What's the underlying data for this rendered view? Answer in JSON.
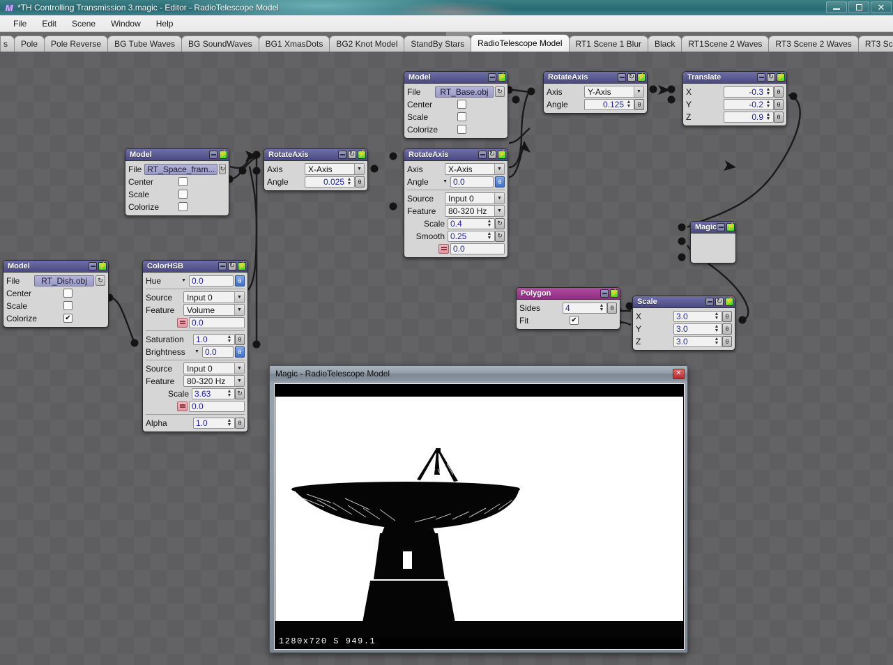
{
  "window": {
    "title": "*TH Controlling Transmission 3.magic - Editor - RadioTelescope Model",
    "app_icon": "M",
    "minimize": "–",
    "maximize": "❐",
    "close": "✕"
  },
  "menubar": {
    "items": [
      {
        "label": "File"
      },
      {
        "label": "Edit"
      },
      {
        "label": "Scene"
      },
      {
        "label": "Window"
      },
      {
        "label": "Help"
      }
    ]
  },
  "tabbar": {
    "tabs": [
      {
        "label": "s",
        "active": false
      },
      {
        "label": "Pole",
        "active": false
      },
      {
        "label": "Pole Reverse",
        "active": false
      },
      {
        "label": "BG Tube Waves",
        "active": false
      },
      {
        "label": "BG SoundWaves",
        "active": false
      },
      {
        "label": "BG1 XmasDots",
        "active": false
      },
      {
        "label": "BG2 Knot Model",
        "active": false
      },
      {
        "label": "StandBy Stars",
        "active": false
      },
      {
        "label": "RadioTelescope Model",
        "active": true
      },
      {
        "label": "RT1 Scene 1 Blur",
        "active": false
      },
      {
        "label": "Black",
        "active": false
      },
      {
        "label": "RT1Scene 2 Waves",
        "active": false
      },
      {
        "label": "RT3 Scene 2 Waves",
        "active": false
      },
      {
        "label": "RT3 Scene 0 Black",
        "active": false
      }
    ]
  },
  "colors": {
    "node_header": "#4a4a80",
    "node_header_magenta": "#8d2f7e",
    "bolt_green": "#49d81d",
    "accent_blue": "#3f6fc8",
    "canvas": "#5e5e60",
    "titlebar": "#2e7279"
  },
  "nodes": {
    "model_spaceframe": {
      "title": "Model",
      "file_label": "File",
      "file_value": "RT_Space_fram...",
      "center_label": "Center",
      "center_checked": false,
      "scale_label": "Scale",
      "scale_checked": false,
      "colorize_label": "Colorize",
      "colorize_checked": false
    },
    "rotateaxis_x": {
      "title": "RotateAxis",
      "axis_label": "Axis",
      "axis_value": "X-Axis",
      "angle_label": "Angle",
      "angle_value": "0.025"
    },
    "model_base": {
      "title": "Model",
      "file_label": "File",
      "file_value": "RT_Base.obj",
      "center_label": "Center",
      "center_checked": false,
      "scale_label": "Scale",
      "scale_checked": false,
      "colorize_label": "Colorize",
      "colorize_checked": false
    },
    "rotateaxis_main": {
      "title": "RotateAxis",
      "axis_label": "Axis",
      "axis_value": "X-Axis",
      "angle_label": "Angle",
      "angle_value": "0.0",
      "source_label": "Source",
      "source_value": "Input 0",
      "feature_label": "Feature",
      "feature_value": "80-320 Hz",
      "scale_label": "Scale",
      "scale_value": "0.4",
      "smooth_label": "Smooth",
      "smooth_value": "0.25",
      "offset_value": "0.0"
    },
    "rotateaxis_y": {
      "title": "RotateAxis",
      "axis_label": "Axis",
      "axis_value": "Y-Axis",
      "angle_label": "Angle",
      "angle_value": "0.125"
    },
    "translate": {
      "title": "Translate",
      "x_label": "X",
      "x_value": "-0.3",
      "y_label": "Y",
      "y_value": "-0.2",
      "z_label": "Z",
      "z_value": "0.9"
    },
    "magic": {
      "title": "Magic"
    },
    "model_dish": {
      "title": "Model",
      "file_label": "File",
      "file_value": "RT_Dish.obj",
      "center_label": "Center",
      "center_checked": false,
      "scale_label": "Scale",
      "scale_checked": false,
      "colorize_label": "Colorize",
      "colorize_checked": true
    },
    "colorhsb": {
      "title": "ColorHSB",
      "hue_label": "Hue",
      "hue_value": "0.0",
      "source1_label": "Source",
      "source1_value": "Input 0",
      "feature1_label": "Feature",
      "feature1_value": "Volume",
      "offset1_value": "0.0",
      "saturation_label": "Saturation",
      "saturation_value": "1.0",
      "brightness_label": "Brightness",
      "brightness_value": "0.0",
      "source2_label": "Source",
      "source2_value": "Input 0",
      "feature2_label": "Feature",
      "feature2_value": "80-320 Hz",
      "scale_label": "Scale",
      "scale_value": "3.63",
      "offset2_value": "0.0",
      "alpha_label": "Alpha",
      "alpha_value": "1.0"
    },
    "polygon": {
      "title": "Polygon",
      "sides_label": "Sides",
      "sides_value": "4",
      "fit_label": "Fit",
      "fit_checked": true
    },
    "scale": {
      "title": "Scale",
      "x_label": "X",
      "x_value": "3.0",
      "y_label": "Y",
      "y_value": "3.0",
      "z_label": "Z",
      "z_value": "3.0"
    }
  },
  "preview": {
    "title": "Magic - RadioTelescope Model",
    "close_label": "✕",
    "status": "1280x720 S 949.1",
    "render_subject": "radio-telescope-dish-silhouette"
  },
  "icons": {
    "minimize": "–",
    "refresh": "↻",
    "bolt": "⚡",
    "dropdown": "▼",
    "caret_down": "▼",
    "spin_up": "▲",
    "spin_down": "▼",
    "link": "θ",
    "check": "✔",
    "reload": "↺"
  }
}
